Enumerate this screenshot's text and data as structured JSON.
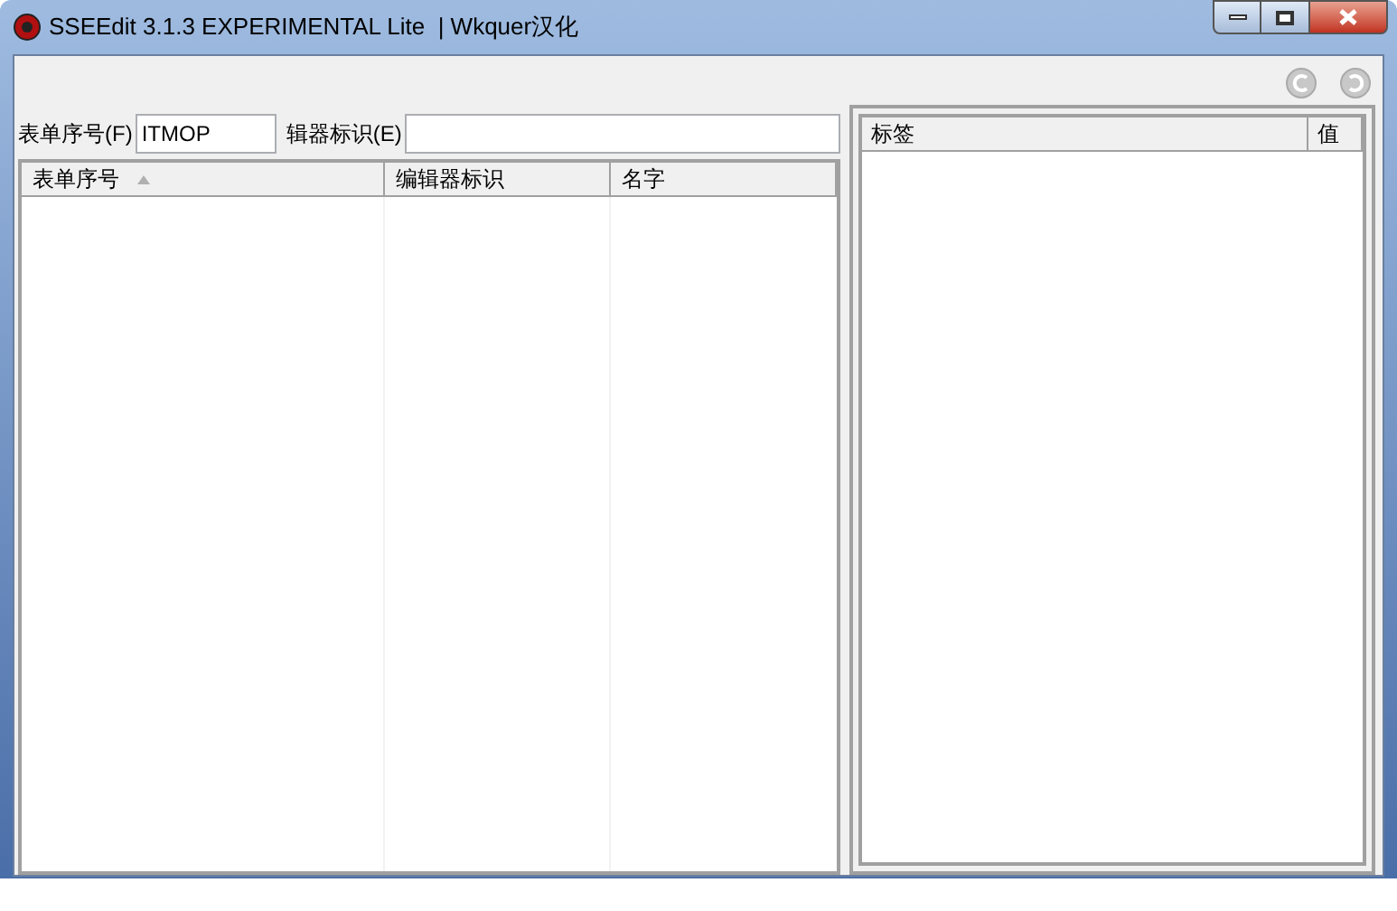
{
  "window": {
    "title": "SSEEdit 3.1.3 EXPERIMENTAL Lite  | Wkquer汉化"
  },
  "filter": [
    {
      "label": "表单序号(F)",
      "value": "ITMOP"
    },
    {
      "label": "辑器标识(E)"
    }
  ],
  "records_table": {
    "columns": [
      {
        "label": "表单序号",
        "sorted": true
      },
      {
        "label": "编辑器标识",
        "sorted": false
      },
      {
        "label": "名字",
        "sorted": false
      }
    ]
  },
  "details_table": {
    "columns": [
      {
        "label": "标签"
      },
      {
        "label": "值"
      }
    ]
  }
}
